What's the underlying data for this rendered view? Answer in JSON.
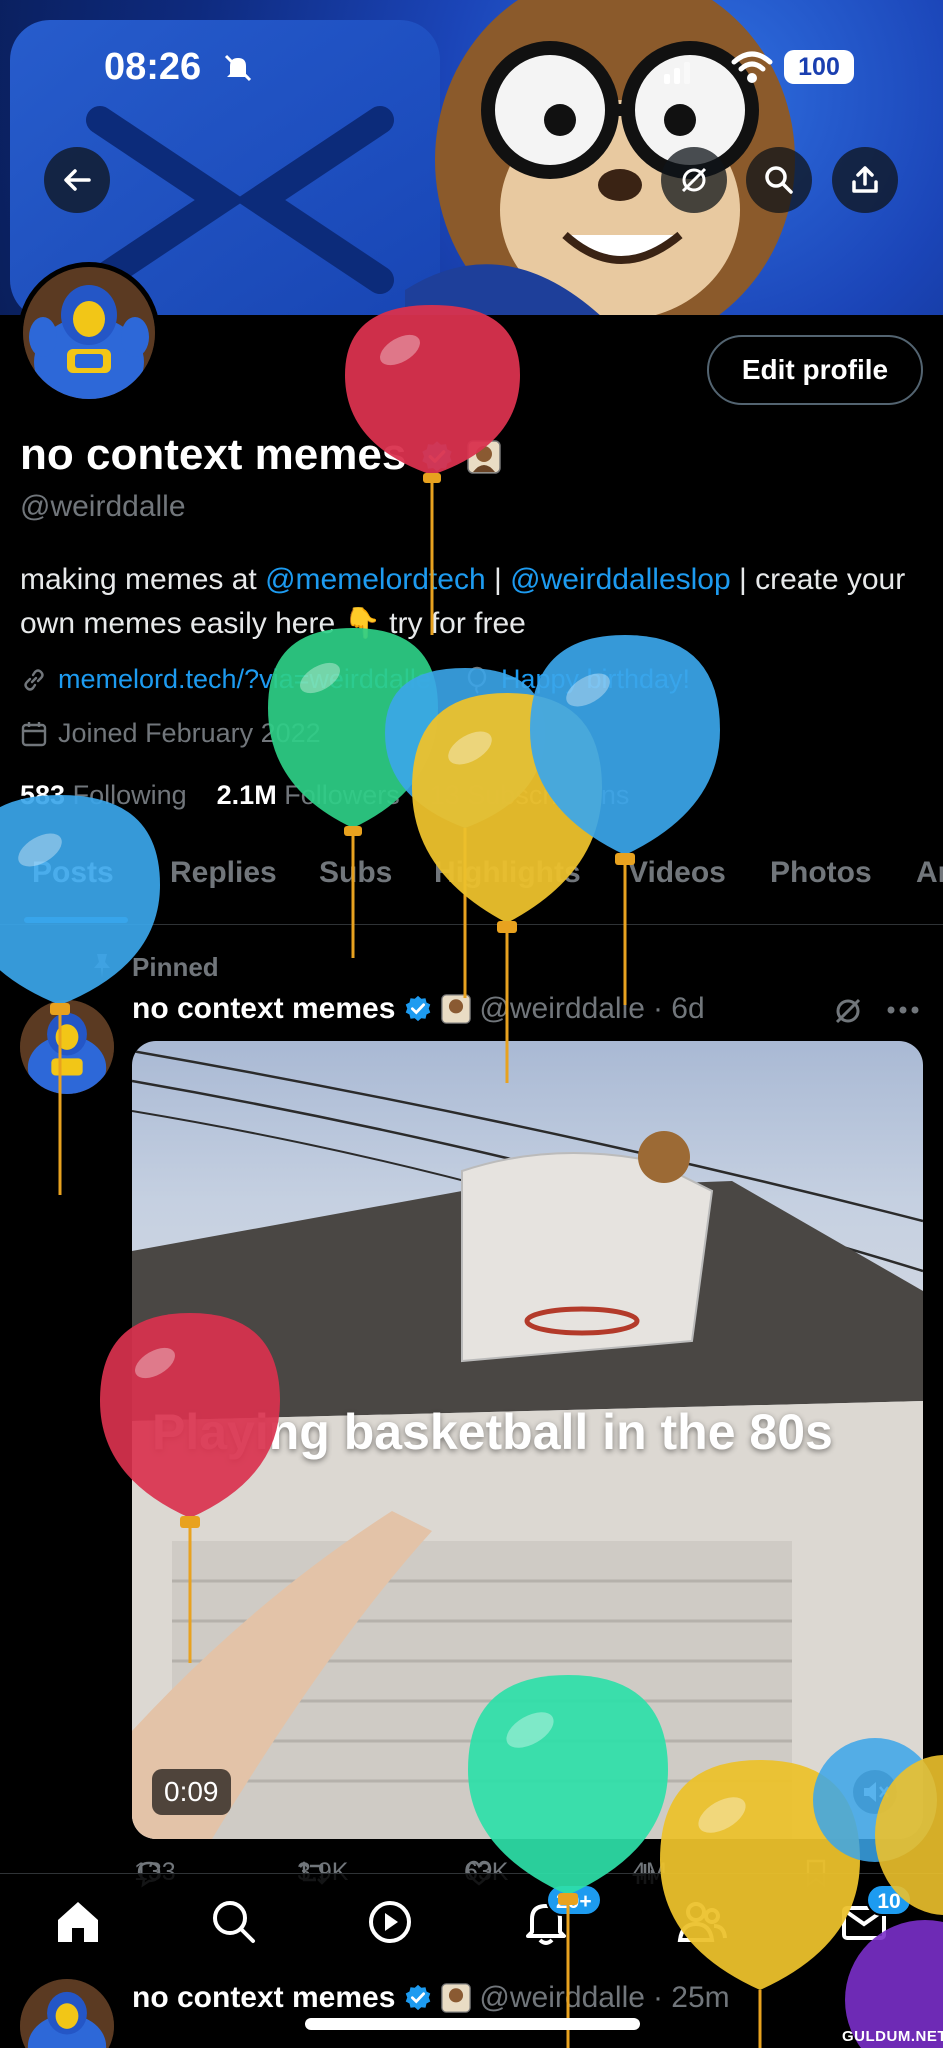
{
  "status_bar": {
    "time": "08:26",
    "battery": "100"
  },
  "profile": {
    "name": "no context memes",
    "handle": "@weirddalle",
    "edit_button": "Edit profile",
    "bio": {
      "prefix": "making memes at ",
      "mention1": "@memelordtech",
      "sep1": " | ",
      "mention2": "@weirddalleslop",
      "suffix": " | create your own memes easily here 👇 try for free"
    },
    "link": "memelord.tech/?via=weirddalle",
    "birthday": "Happy birthday!",
    "joined": "Joined February 2022",
    "following_count": "583",
    "following_label": "Following",
    "followers_count": "2.1M",
    "followers_label": "Followers",
    "subscriptions": "13 Subscriptions"
  },
  "tabs": [
    "Posts",
    "Replies",
    "Subs",
    "Highlights",
    "Videos",
    "Photos",
    "Ar"
  ],
  "pinned_post": {
    "pinned_label": "Pinned",
    "author": "no context memes",
    "handle": "@weirddalle",
    "time": "· 6d",
    "video_caption": "Playing basketball in the 80s",
    "duration": "0:09",
    "replies": "133",
    "reposts": "3.9K",
    "likes": "63K",
    "views": "4M"
  },
  "next_post": {
    "author": "no context memes",
    "handle": "@weirddalle",
    "time": "· 25m"
  },
  "bottom_nav": {
    "notifications_badge": "20+",
    "messages_badge": "10"
  },
  "watermark": "GULDUM.NET",
  "colors": {
    "accent": "#1d9bf0",
    "background": "#000000",
    "muted": "#71767b"
  },
  "icons": [
    "back-arrow-icon",
    "grok-icon",
    "search-icon",
    "share-icon",
    "verified-badge-icon",
    "link-icon",
    "balloon-icon",
    "calendar-icon",
    "pin-icon",
    "more-icon",
    "reply-icon",
    "repost-icon",
    "like-icon",
    "views-icon",
    "bookmark-icon",
    "home-icon",
    "play-icon",
    "bell-icon",
    "people-icon",
    "mail-icon"
  ]
}
